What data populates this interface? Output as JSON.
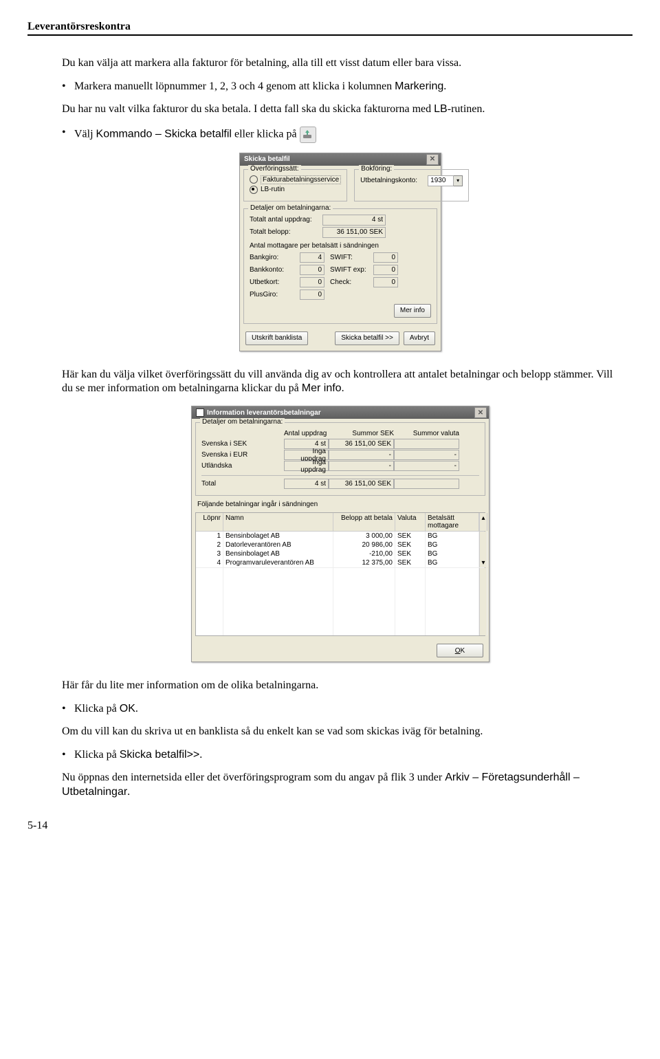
{
  "header": {
    "title": "Leverantörsreskontra"
  },
  "body": {
    "p1": "Du kan välja att markera alla fakturor för betalning, alla till ett visst datum eller bara vissa.",
    "b1_pre": "Markera manuellt löpnummer 1, 2, 3 och 4 genom att klicka i kolumnen ",
    "b1_sans": "Markering",
    "b1_post": ".",
    "p2_pre": "Du har nu valt vilka fakturor du ska betala. I detta fall ska du skicka fakturorna med ",
    "p2_sans": "LB",
    "p2_post": "-rutinen.",
    "b2_pre": "Välj ",
    "b2_sans": "Kommando – Skicka betalfil",
    "b2_mid": " eller klicka på",
    "p3_pre": "Här kan du välja vilket överföringssätt du vill använda dig av och kontrollera att antalet betalningar och belopp stämmer. Vill du se mer information om betalningarna klickar du på ",
    "p3_sans": "Mer info",
    "p3_post": ".",
    "p4": "Här får du lite mer information om de olika betalningarna.",
    "b3_pre": "Klicka på ",
    "b3_sans": "OK",
    "b3_post": ".",
    "p5": "Om du vill kan du skriva ut en banklista så du enkelt kan se vad som skickas iväg för betalning.",
    "b4_pre": "Klicka på ",
    "b4_sans": "Skicka betalfil>>",
    "b4_post": ".",
    "p6_pre": "Nu öppnas den internetsida eller det överföringsprogram som du angav på flik 3 under ",
    "p6_sans": "Arkiv – Företagsunderhåll – Utbetalningar",
    "p6_post": "."
  },
  "dialog1": {
    "title": "Skicka betalfil",
    "group_transfer": "Överföringssätt:",
    "group_booking": "Bokföring:",
    "opt_fakturabet": "Fakturabetalningsservice",
    "opt_lb": "LB-rutin",
    "utbet_label": "Utbetalningskonto:",
    "utbet_value": "1930",
    "group_details": "Detaljer om betalningarna:",
    "total_antal_label": "Totalt antal uppdrag:",
    "total_antal_value": "4 st",
    "total_belopp_label": "Totalt belopp:",
    "total_belopp_value": "36 151,00 SEK",
    "antal_mottagare": "Antal mottagare per betalsätt i sändningen",
    "bankgiro_l": "Bankgiro:",
    "bankgiro_v": "4",
    "swift_l": "SWIFT:",
    "swift_v": "0",
    "bankkonto_l": "Bankkonto:",
    "bankkonto_v": "0",
    "swiftexp_l": "SWIFT exp:",
    "swiftexp_v": "0",
    "utbetkort_l": "Utbetkort:",
    "utbetkort_v": "0",
    "check_l": "Check:",
    "check_v": "0",
    "plusgiro_l": "PlusGiro:",
    "plusgiro_v": "0",
    "btn_merinfo": "Mer info",
    "btn_utskrift": "Utskrift banklista",
    "btn_skicka": "Skicka betalfil >>",
    "btn_avbryt": "Avbryt"
  },
  "dialog2": {
    "title": "Information leverantörsbetalningar",
    "group": "Detaljer om betalningarna:",
    "col_antal": "Antal uppdrag",
    "col_sumsek": "Summor SEK",
    "col_sumval": "Summor valuta",
    "rows": [
      {
        "label": "Svenska i SEK",
        "antal": "4 st",
        "sek": "36 151,00 SEK",
        "valuta": ""
      },
      {
        "label": "Svenska i EUR",
        "antal": "Inga uppdrag",
        "sek": "-",
        "valuta": "-"
      },
      {
        "label": "Utländska",
        "antal": "Inga uppdrag",
        "sek": "-",
        "valuta": "-"
      }
    ],
    "total_label": "Total",
    "total_antal": "4 st",
    "total_sek": "36 151,00 SEK",
    "foljande": "Följande betalningar ingår i sändningen",
    "th_lopnr": "Löpnr",
    "th_namn": "Namn",
    "th_belopp": "Belopp att betala",
    "th_valuta": "Valuta",
    "th_betalsatt": "Betalsätt mottagare",
    "items": [
      {
        "nr": "1",
        "namn": "Bensinbolaget AB",
        "belopp": "3 000,00",
        "valuta": "SEK",
        "bs": "BG"
      },
      {
        "nr": "2",
        "namn": "Datorleverantören AB",
        "belopp": "20 986,00",
        "valuta": "SEK",
        "bs": "BG"
      },
      {
        "nr": "3",
        "namn": "Bensinbolaget AB",
        "belopp": "-210,00",
        "valuta": "SEK",
        "bs": "BG"
      },
      {
        "nr": "4",
        "namn": "Programvaruleverantören AB",
        "belopp": "12 375,00",
        "valuta": "SEK",
        "bs": "BG"
      }
    ],
    "btn_ok": "OK"
  },
  "pagenum": "5-14"
}
